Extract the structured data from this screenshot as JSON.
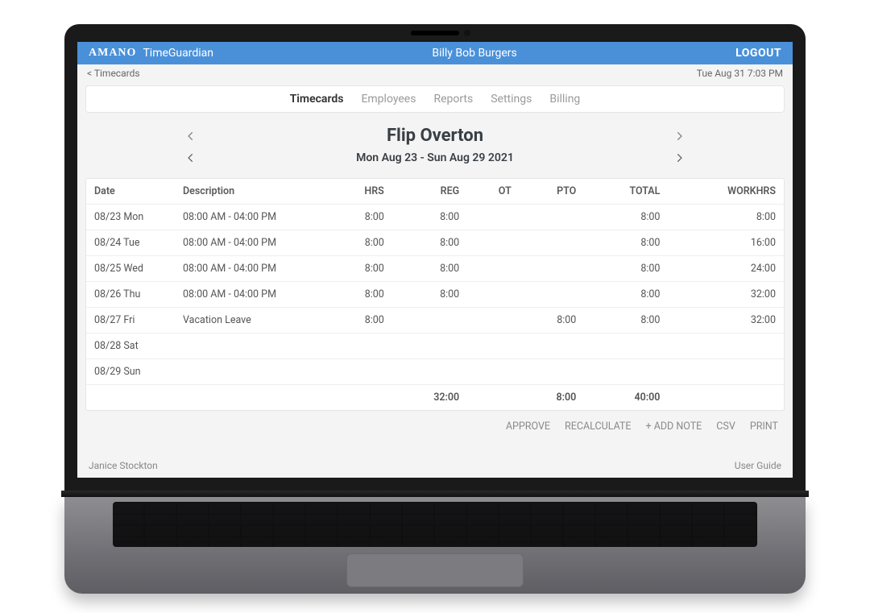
{
  "brand": {
    "logo": "AMANO",
    "product": "TimeGuardian"
  },
  "header": {
    "company": "Billy Bob Burgers",
    "logout": "LOGOUT"
  },
  "subheader": {
    "breadcrumb": "< Timecards",
    "datetime": "Tue Aug 31 7:03 PM"
  },
  "tabs": {
    "items": [
      "Timecards",
      "Employees",
      "Reports",
      "Settings",
      "Billing"
    ],
    "active_index": 0
  },
  "employee": {
    "name": "Flip Overton"
  },
  "period": {
    "range": "Mon Aug 23 - Sun Aug 29 2021"
  },
  "columns": {
    "date": "Date",
    "desc": "Description",
    "hrs": "HRS",
    "reg": "REG",
    "ot": "OT",
    "pto": "PTO",
    "total": "TOTAL",
    "workhrs": "WORKHRS"
  },
  "rows": [
    {
      "date": "08/23 Mon",
      "desc": "08:00 AM - 04:00 PM",
      "hrs": "8:00",
      "reg": "8:00",
      "ot": "",
      "pto": "",
      "total": "8:00",
      "workhrs": "8:00"
    },
    {
      "date": "08/24 Tue",
      "desc": "08:00 AM - 04:00 PM",
      "hrs": "8:00",
      "reg": "8:00",
      "ot": "",
      "pto": "",
      "total": "8:00",
      "workhrs": "16:00"
    },
    {
      "date": "08/25 Wed",
      "desc": "08:00 AM - 04:00 PM",
      "hrs": "8:00",
      "reg": "8:00",
      "ot": "",
      "pto": "",
      "total": "8:00",
      "workhrs": "24:00"
    },
    {
      "date": "08/26 Thu",
      "desc": "08:00 AM - 04:00 PM",
      "hrs": "8:00",
      "reg": "8:00",
      "ot": "",
      "pto": "",
      "total": "8:00",
      "workhrs": "32:00"
    },
    {
      "date": "08/27 Fri",
      "desc": "Vacation Leave",
      "hrs": "8:00",
      "reg": "",
      "ot": "",
      "pto": "8:00",
      "total": "8:00",
      "workhrs": "32:00"
    },
    {
      "date": "08/28 Sat",
      "desc": "",
      "hrs": "",
      "reg": "",
      "ot": "",
      "pto": "",
      "total": "",
      "workhrs": ""
    },
    {
      "date": "08/29 Sun",
      "desc": "",
      "hrs": "",
      "reg": "",
      "ot": "",
      "pto": "",
      "total": "",
      "workhrs": ""
    }
  ],
  "totals": {
    "reg": "32:00",
    "pto": "8:00",
    "total": "40:00"
  },
  "actions": {
    "approve": "APPROVE",
    "recalculate": "RECALCULATE",
    "add_note": "+ ADD NOTE",
    "csv": "CSV",
    "print": "PRINT"
  },
  "footer": {
    "user": "Janice Stockton",
    "guide": "User Guide"
  }
}
